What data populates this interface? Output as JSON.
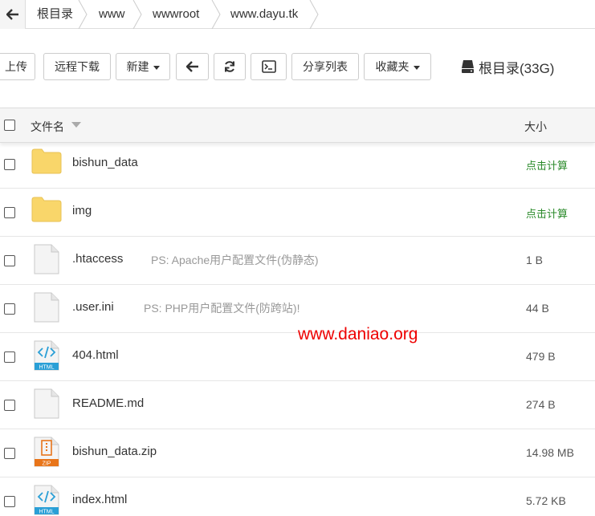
{
  "breadcrumb": {
    "items": [
      "根目录",
      "www",
      "wwwroot",
      "www.dayu.tk"
    ]
  },
  "toolbar": {
    "upload": "上传",
    "remote_download": "远程下载",
    "new": "新建",
    "share_list": "分享列表",
    "favorites": "收藏夹",
    "disk": "根目录(33G)"
  },
  "table": {
    "col_name": "文件名",
    "col_size": "大小",
    "rows": [
      {
        "name": "bishun_data",
        "type": "folder",
        "size": "点击计算",
        "note": ""
      },
      {
        "name": "img",
        "type": "folder",
        "size": "点击计算",
        "note": ""
      },
      {
        "name": ".htaccess",
        "type": "file",
        "size": "1 B",
        "note": "PS: Apache用户配置文件(伪静态)"
      },
      {
        "name": ".user.ini",
        "type": "file",
        "size": "44 B",
        "note": "PS: PHP用户配置文件(防跨站)!"
      },
      {
        "name": "404.html",
        "type": "html",
        "size": "479 B",
        "note": ""
      },
      {
        "name": "README.md",
        "type": "file",
        "size": "274 B",
        "note": ""
      },
      {
        "name": "bishun_data.zip",
        "type": "zip",
        "size": "14.98 MB",
        "note": ""
      },
      {
        "name": "index.html",
        "type": "html",
        "size": "5.72 KB",
        "note": ""
      }
    ]
  },
  "icons": {
    "html_label": "HTML",
    "zip_label": "ZIP"
  },
  "watermark": "www.daniao.org",
  "colors": {
    "folder": "#f9d66a",
    "calc_link": "#2a8a2a",
    "html_icon": "#2a9fd6",
    "zip_icon": "#e8751a",
    "watermark": "#ee0000"
  }
}
